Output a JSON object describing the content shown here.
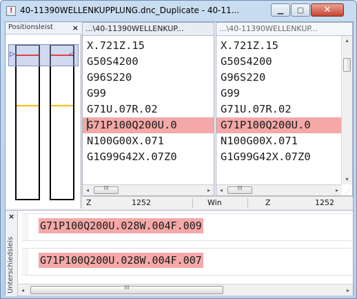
{
  "window": {
    "title": "40-11390WELLENKUPPLUNG.dnc_Duplicate - 40-11...",
    "app_icon": "document-warning-icon",
    "buttons": {
      "minimize": "minimize-icon",
      "maximize": "maximize-icon",
      "close": "close-icon"
    }
  },
  "position_panel": {
    "label": "Positionsleist",
    "close": "×"
  },
  "left_pane": {
    "tab": "...\\40-11390WELLENKUP...",
    "lines": [
      "X.721Z.15",
      "G50S4200",
      "G96S220",
      "G99",
      "G71U.07R.02",
      "G71P100Q200U.0",
      "N100G00X.071",
      "G1G99G42X.07Z0"
    ],
    "diff_line_index": 5
  },
  "right_pane": {
    "tab": "...\\40-11390WELLENKUP...",
    "lines": [
      "X.721Z.15",
      "G50S4200",
      "G96S220",
      "G99",
      "G71U.07R.02",
      "G71P100Q200U.0",
      "N100G00X.071",
      "G1G99G42X.07Z0"
    ],
    "diff_line_index": 5
  },
  "status": {
    "left_axis": "Z",
    "left_value": "1252",
    "win": "Win",
    "right_axis": "Z",
    "right_value": "1252"
  },
  "diff_panel": {
    "close": "×",
    "label": "Unterschiedsleis",
    "rows": [
      "G71P100Q200U.028W.004F.009",
      "G71P100Q200U.028W.004F.007"
    ]
  },
  "scroll": {
    "left_arrow": "◂",
    "right_arrow": "▸",
    "up_arrow": "▴",
    "down_arrow": "▾",
    "grip": "III"
  }
}
